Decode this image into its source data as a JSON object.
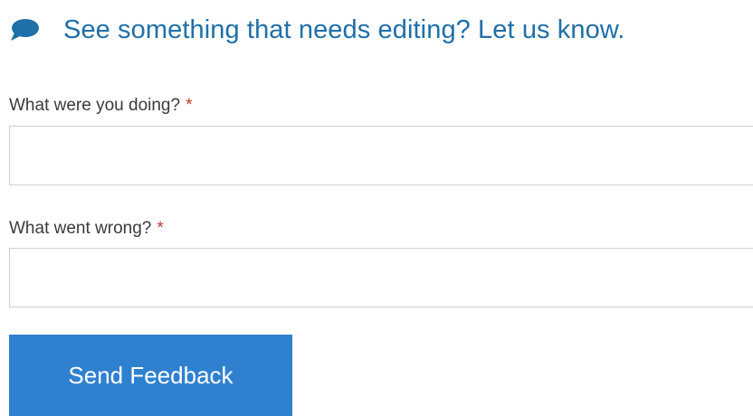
{
  "header": {
    "icon": "speech-bubble-icon",
    "title": "See something that needs editing? Let us know."
  },
  "form": {
    "fields": [
      {
        "label": "What were you doing?",
        "required_mark": "*",
        "value": ""
      },
      {
        "label": "What went wrong?",
        "required_mark": "*",
        "value": ""
      }
    ],
    "submit_label": "Send Feedback"
  },
  "colors": {
    "accent_text": "#1f6fa8",
    "button_bg": "#2f81d0",
    "required": "#c0392b"
  }
}
